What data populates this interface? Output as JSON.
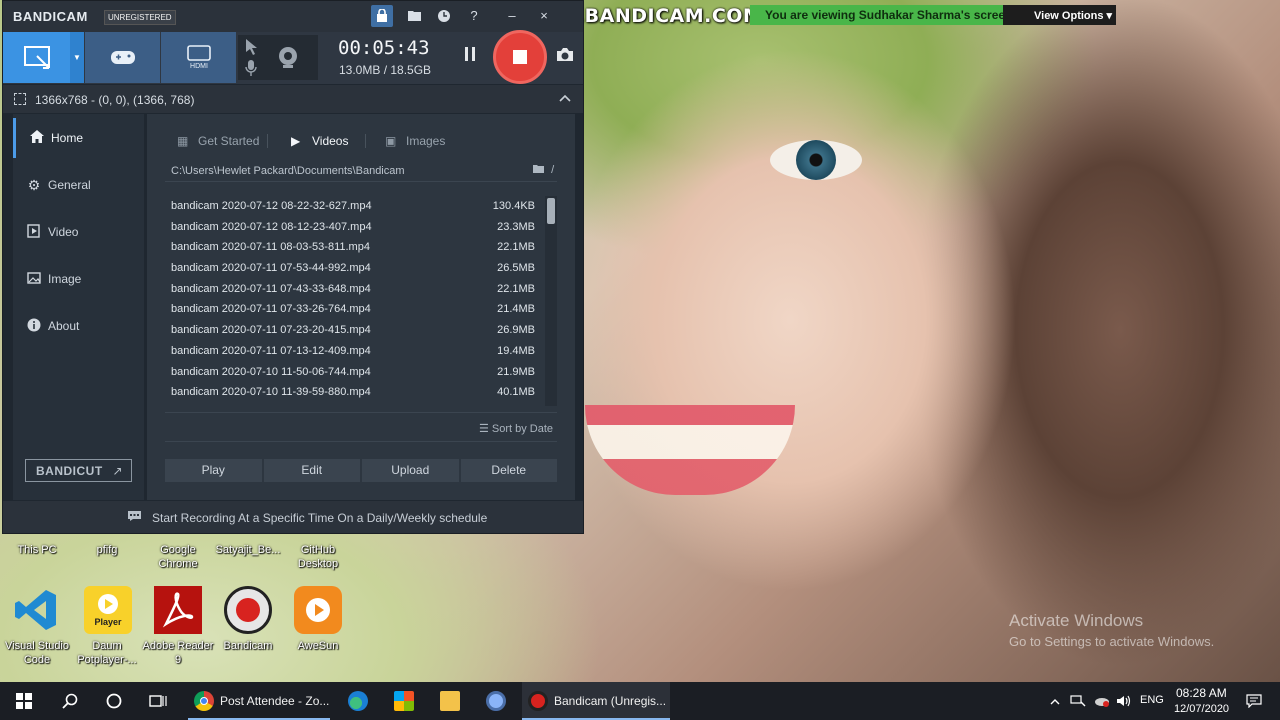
{
  "watermark": "www.BANDICAM.COM",
  "share_bar": {
    "text": "You are viewing Sudhakar Sharma's screen",
    "view_options": "View Options",
    "view_options_chevron": "▾"
  },
  "bandicam": {
    "logo": "BANDICAM",
    "badge": "UNREGISTERED",
    "titlebar_icons": [
      "lock-icon",
      "folder-icon",
      "clock-icon",
      "help-icon",
      "minimize-icon",
      "close-icon"
    ],
    "titlebar_glyphs": {
      "minimize": "–",
      "close": "×"
    },
    "timer": "00:05:43",
    "size": "13.0MB / 18.5GB",
    "region": "1366x768 - (0, 0), (1366, 768)",
    "sidebar": [
      {
        "label": "Home",
        "icon": "home-icon"
      },
      {
        "label": "General",
        "icon": "gear-icon"
      },
      {
        "label": "Video",
        "icon": "video-icon"
      },
      {
        "label": "Image",
        "icon": "image-icon"
      },
      {
        "label": "About",
        "icon": "info-icon"
      }
    ],
    "bandicut": "BANDICUT",
    "bandicut_arrow": "↗",
    "tabs": {
      "get_started": "Get Started",
      "videos": "Videos",
      "images": "Images"
    },
    "path": "C:\\Users\\Hewlet Packard\\Documents\\Bandicam",
    "path_up": "/",
    "files": [
      {
        "name": "bandicam 2020-07-12 08-22-32-627.mp4",
        "size": "130.4KB"
      },
      {
        "name": "bandicam 2020-07-12 08-12-23-407.mp4",
        "size": "23.3MB"
      },
      {
        "name": "bandicam 2020-07-11 08-03-53-811.mp4",
        "size": "22.1MB"
      },
      {
        "name": "bandicam 2020-07-11 07-53-44-992.mp4",
        "size": "26.5MB"
      },
      {
        "name": "bandicam 2020-07-11 07-43-33-648.mp4",
        "size": "22.1MB"
      },
      {
        "name": "bandicam 2020-07-11 07-33-26-764.mp4",
        "size": "21.4MB"
      },
      {
        "name": "bandicam 2020-07-11 07-23-20-415.mp4",
        "size": "26.9MB"
      },
      {
        "name": "bandicam 2020-07-11 07-13-12-409.mp4",
        "size": "19.4MB"
      },
      {
        "name": "bandicam 2020-07-10 11-50-06-744.mp4",
        "size": "21.9MB"
      },
      {
        "name": "bandicam 2020-07-10 11-39-59-880.mp4",
        "size": "40.1MB"
      }
    ],
    "sort_by": "Sort by Date",
    "actions": {
      "play": "Play",
      "edit": "Edit",
      "upload": "Upload",
      "delete": "Delete"
    },
    "footer": "Start Recording At a Specific Time On a Daily/Weekly schedule"
  },
  "desktop_icons": {
    "row1": [
      "This PC",
      "pfifg",
      "Google Chrome",
      "Satyajit_Be...",
      "GitHub Desktop"
    ],
    "row2": [
      "Visual Studio Code",
      "Daum Potplayer-...",
      "Adobe Reader 9",
      "Bandicam",
      "AweSun"
    ]
  },
  "daum_icon_text": "Player",
  "activate": {
    "title": "Activate Windows",
    "sub": "Go to Settings to activate Windows."
  },
  "taskbar": {
    "apps": [
      {
        "label": "Post Attendee - Zo...",
        "icon": "chrome-icon"
      },
      {
        "label": "Bandicam (Unregis...",
        "icon": "bandicam-icon"
      }
    ],
    "lang": "ENG",
    "time": "08:28 AM",
    "date": "12/07/2020"
  }
}
